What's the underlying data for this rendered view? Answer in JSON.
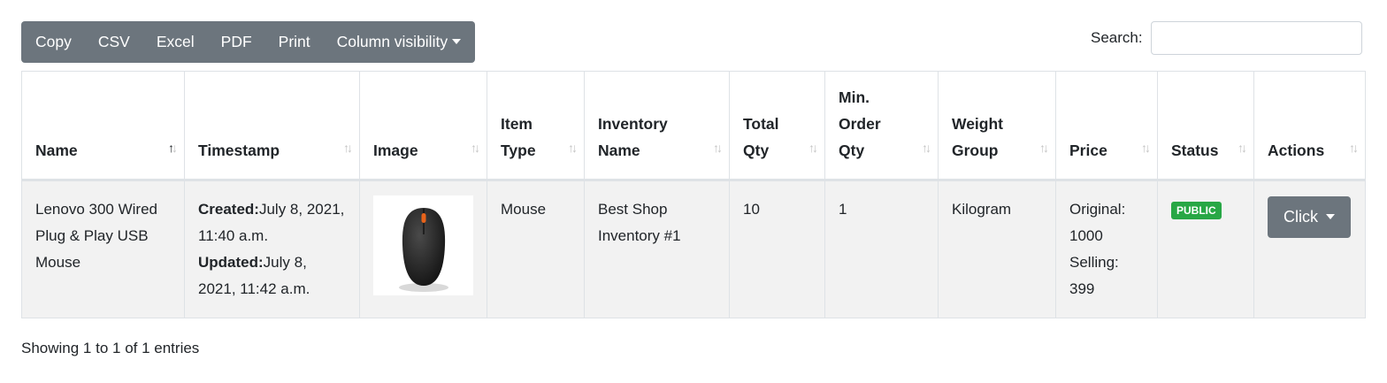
{
  "toolbar": {
    "buttons": [
      "Copy",
      "CSV",
      "Excel",
      "PDF",
      "Print"
    ],
    "column_visibility": "Column visibility"
  },
  "search": {
    "label": "Search:",
    "value": ""
  },
  "table": {
    "headers": {
      "name": "Name",
      "timestamp": "Timestamp",
      "image": "Image",
      "item_type_1": "Item",
      "item_type_2": "Type",
      "inventory_1": "Inventory",
      "inventory_2": "Name",
      "total_1": "Total",
      "total_2": "Qty",
      "min_1": "Min.",
      "min_2": "Order",
      "min_3": "Qty",
      "weight_1": "Weight",
      "weight_2": "Group",
      "price": "Price",
      "status": "Status",
      "actions": "Actions"
    },
    "row": {
      "name": "Lenovo 300 Wired Plug & Play USB Mouse",
      "created_label": "Created:",
      "created_value": "July 8, 2021, 11:40 a.m.",
      "updated_label": "Updated:",
      "updated_value": "July 8, 2021, 11:42 a.m.",
      "item_type": "Mouse",
      "inventory_name": "Best Shop Inventory #1",
      "total_qty": "10",
      "min_order_qty": "1",
      "weight_group": "Kilogram",
      "price_original": "Original: 1000",
      "price_selling": "Selling: 399",
      "status": "PUBLIC",
      "action": "Click"
    }
  },
  "info": "Showing 1 to 1 of 1 entries",
  "colors": {
    "toolbar": "#6c757d",
    "badge": "#28a745",
    "row_bg": "#f2f2f2"
  }
}
